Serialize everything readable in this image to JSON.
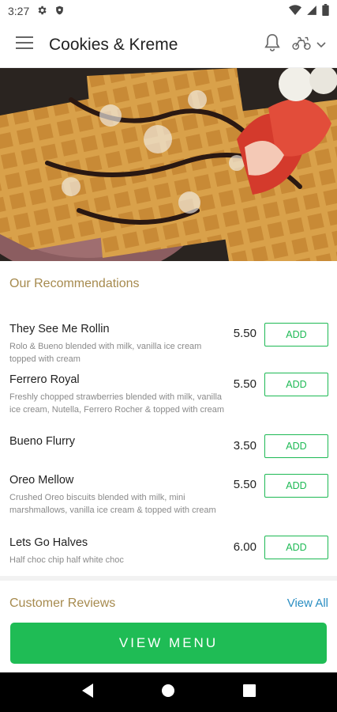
{
  "status_bar": {
    "time": "3:27",
    "left_icons": [
      "gear-icon",
      "shield-icon"
    ],
    "right_icons": [
      "wifi-icon",
      "signal-icon",
      "battery-icon"
    ]
  },
  "app_bar": {
    "title": "Cookies & Kreme",
    "icons": [
      "hamburger-menu-icon",
      "bell-icon",
      "scooter-icon",
      "chevron-down-icon"
    ]
  },
  "hero": {
    "description": "photo"
  },
  "recommendations": {
    "title": "Our Recommendations",
    "items": [
      {
        "name": "They See Me Rollin",
        "description": "Rolo & Bueno blended with milk, vanilla ice cream topped with cream",
        "price": "5.50",
        "add_label": "ADD"
      },
      {
        "name": "Ferrero Royal",
        "description": "Freshly chopped strawberries blended with milk, vanilla ice cream, Nutella, Ferrero Rocher & topped with cream",
        "price": "5.50",
        "add_label": "ADD"
      },
      {
        "name": "Bueno Flurry",
        "description": "",
        "price": "3.50",
        "add_label": "ADD"
      },
      {
        "name": "Oreo Mellow",
        "description": "Crushed Oreo biscuits blended with milk, mini marshmallows, vanilla ice cream & topped with cream",
        "price": "5.50",
        "add_label": "ADD"
      },
      {
        "name": "Lets Go Halves",
        "description": "Half choc chip half white choc",
        "price": "6.00",
        "add_label": "ADD"
      }
    ]
  },
  "reviews": {
    "title": "Customer Reviews",
    "view_all": "View All"
  },
  "view_menu_label": "VIEW MENU",
  "colors": {
    "accent_green": "#1fbc55",
    "section_title_gold": "#a68a4e",
    "link_blue": "#2a8ec2"
  },
  "nav_bar": {
    "icons": [
      "back-icon",
      "home-icon",
      "recents-icon"
    ]
  }
}
